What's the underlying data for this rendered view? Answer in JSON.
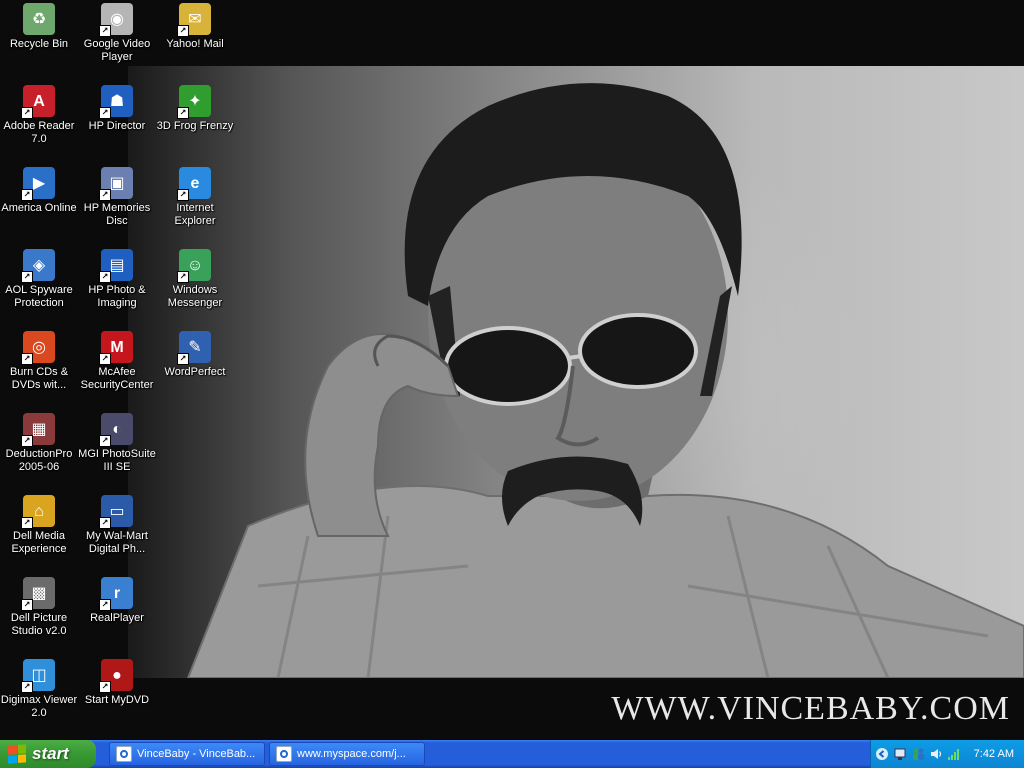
{
  "desktop": {
    "watermark": "WWW.VINCEBABY.COM",
    "icons": [
      {
        "label": "Recycle Bin",
        "icon": "recycle-bin-icon",
        "color": "#6fa86c",
        "glyph": "♻",
        "shortcut": false
      },
      {
        "label": "Google Video Player",
        "icon": "google-video-player-icon",
        "color": "#b5b5b5",
        "glyph": "◉",
        "shortcut": true
      },
      {
        "label": "Yahoo! Mail",
        "icon": "yahoo-mail-icon",
        "color": "#d9b23a",
        "glyph": "✉",
        "shortcut": true
      },
      {
        "label": "Adobe Reader 7.0",
        "icon": "adobe-reader-icon",
        "color": "#c8202a",
        "glyph": "A",
        "shortcut": true
      },
      {
        "label": "HP Director",
        "icon": "hp-director-icon",
        "color": "#1f5fbf",
        "glyph": "☗",
        "shortcut": true
      },
      {
        "label": "3D Frog Frenzy",
        "icon": "frog-frenzy-icon",
        "color": "#2f9e2f",
        "glyph": "✦",
        "shortcut": true
      },
      {
        "label": "America Online",
        "icon": "aol-icon",
        "color": "#2a70c8",
        "glyph": "▶",
        "shortcut": true
      },
      {
        "label": "HP Memories Disc",
        "icon": "hp-memories-disc-icon",
        "color": "#6b7fb0",
        "glyph": "▣",
        "shortcut": true
      },
      {
        "label": "Internet Explorer",
        "icon": "internet-explorer-icon",
        "color": "#2a8ae0",
        "glyph": "e",
        "shortcut": true
      },
      {
        "label": "AOL Spyware Protection",
        "icon": "aol-spyware-icon",
        "color": "#3a78c9",
        "glyph": "◈",
        "shortcut": true
      },
      {
        "label": "HP Photo & Imaging",
        "icon": "hp-photo-imaging-icon",
        "color": "#1f5fbf",
        "glyph": "▤",
        "shortcut": true
      },
      {
        "label": "Windows Messenger",
        "icon": "windows-messenger-icon",
        "color": "#3aa15a",
        "glyph": "☺",
        "shortcut": true
      },
      {
        "label": "Burn CDs & DVDs wit...",
        "icon": "burn-cds-icon",
        "color": "#d9481e",
        "glyph": "◎",
        "shortcut": true
      },
      {
        "label": "McAfee SecurityCenter",
        "icon": "mcafee-icon",
        "color": "#c4161c",
        "glyph": "M",
        "shortcut": true
      },
      {
        "label": "WordPerfect",
        "icon": "wordperfect-icon",
        "color": "#3060b0",
        "glyph": "✎",
        "shortcut": true
      },
      {
        "label": "DeductionPro 2005-06",
        "icon": "deductionpro-icon",
        "color": "#8a3a3a",
        "glyph": "▦",
        "shortcut": true
      },
      {
        "label": "MGI PhotoSuite III SE",
        "icon": "mgi-photosuite-icon",
        "color": "#4a4a6a",
        "glyph": "◐",
        "shortcut": true
      },
      {
        "label": "Dell Media Experience",
        "icon": "dell-media-experience-icon",
        "color": "#d9a520",
        "glyph": "⌂",
        "shortcut": true
      },
      {
        "label": "My Wal-Mart Digital Ph...",
        "icon": "walmart-digital-photo-icon",
        "color": "#2a5aa8",
        "glyph": "▭",
        "shortcut": true
      },
      {
        "label": "Dell Picture Studio v2.0",
        "icon": "dell-picture-studio-icon",
        "color": "#6b6b6b",
        "glyph": "▩",
        "shortcut": true
      },
      {
        "label": "RealPlayer",
        "icon": "realplayer-icon",
        "color": "#3a7fd0",
        "glyph": "r",
        "shortcut": true
      },
      {
        "label": "Digimax Viewer 2.0",
        "icon": "digimax-viewer-icon",
        "color": "#2f8fd8",
        "glyph": "◫",
        "shortcut": true
      },
      {
        "label": "Start MyDVD",
        "icon": "start-mydvd-icon",
        "color": "#b01818",
        "glyph": "●",
        "shortcut": true
      }
    ]
  },
  "taskbar": {
    "start_label": "start",
    "tasks": [
      {
        "label": "VinceBaby - VinceBab..."
      },
      {
        "label": "www.myspace.com/j..."
      }
    ],
    "tray_icons": [
      "chevron-left-icon",
      "network-icon",
      "messenger-tray-icon",
      "speaker-icon",
      "signal-strength-icon"
    ],
    "clock": "7:42 AM"
  }
}
